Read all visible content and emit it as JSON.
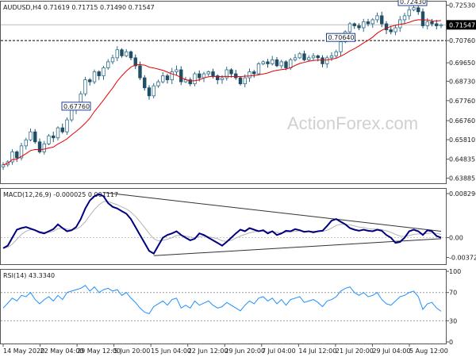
{
  "chart_data": [
    {
      "type": "candlestick",
      "title": "AUDUSD,H4",
      "ohlc": {
        "open": "0.71619",
        "high": "0.71715",
        "low": "0.71490",
        "close": "0.71547"
      },
      "ylim": [
        0.6375,
        0.7255
      ],
      "y_ticks": [
        "0.72530",
        "0.71547",
        "0.70760",
        "0.69650",
        "0.68730",
        "0.67760",
        "0.66760",
        "0.65810",
        "0.64835",
        "0.63885"
      ],
      "x_ticks": [
        "14 May 2020",
        "22 May 04:00",
        "29 May 12:00",
        "5 Jun 20:00",
        "15 Jun 04:00",
        "22 Jun 12:00",
        "29 Jun 20:00",
        "7 Jul 04:00",
        "14 Jul 12:00",
        "21 Jul 20:00",
        "29 Jul 04:00",
        "5 Aug 12:00"
      ],
      "annotations": [
        {
          "label": "0.70640",
          "value": 0.7064
        },
        {
          "label": "0.67760",
          "value": 0.6776
        },
        {
          "label": "0.72430",
          "value": 0.7243
        }
      ],
      "horizontal_lines": [
        {
          "label": "0.70760",
          "value": 0.7076,
          "style": "dashed"
        }
      ],
      "current_price": {
        "label": "0.71547",
        "value": 0.71547
      },
      "series_close": [
        0.6455,
        0.647,
        0.652,
        0.649,
        0.655,
        0.658,
        0.662,
        0.657,
        0.652,
        0.656,
        0.66,
        0.659,
        0.664,
        0.662,
        0.668,
        0.673,
        0.676,
        0.681,
        0.688,
        0.687,
        0.692,
        0.69,
        0.694,
        0.697,
        0.699,
        0.703,
        0.7,
        0.702,
        0.699,
        0.695,
        0.689,
        0.684,
        0.68,
        0.685,
        0.687,
        0.69,
        0.688,
        0.692,
        0.693,
        0.687,
        0.688,
        0.686,
        0.691,
        0.689,
        0.691,
        0.692,
        0.69,
        0.688,
        0.689,
        0.693,
        0.691,
        0.689,
        0.686,
        0.689,
        0.692,
        0.691,
        0.696,
        0.697,
        0.696,
        0.698,
        0.695,
        0.697,
        0.694,
        0.698,
        0.699,
        0.701,
        0.698,
        0.699,
        0.7,
        0.699,
        0.696,
        0.699,
        0.7,
        0.702,
        0.707,
        0.712,
        0.716,
        0.715,
        0.714,
        0.717,
        0.716,
        0.718,
        0.72,
        0.716,
        0.713,
        0.712,
        0.714,
        0.718,
        0.72,
        0.723,
        0.724,
        0.722,
        0.715,
        0.717,
        0.716,
        0.715,
        0.7155
      ]
    },
    {
      "type": "line",
      "title": "MACD(12,26,9) -0.000025 0.001117",
      "ylim": [
        -0.0047,
        0.0089
      ],
      "y_ticks": [
        "0.008296",
        "0.00",
        "-0.003725"
      ],
      "series": [
        {
          "name": "MACD",
          "color": "#00007f",
          "values": [
            -0.002,
            -0.0015,
            0.0,
            0.0015,
            0.0018,
            0.002,
            0.0017,
            0.0014,
            0.001,
            0.0008,
            0.0012,
            0.0016,
            0.0025,
            0.0018,
            0.0012,
            0.0014,
            0.002,
            0.0035,
            0.0055,
            0.007,
            0.0078,
            0.0082,
            0.0078,
            0.0065,
            0.0058,
            0.0055,
            0.005,
            0.0045,
            0.0035,
            0.002,
            0.0005,
            -0.001,
            -0.0025,
            -0.003,
            -0.0015,
            0.0,
            0.0005,
            0.0008,
            0.0012,
            0.0005,
            0.0,
            -0.0005,
            -0.0002,
            0.0008,
            0.0005,
            0.0,
            -0.0005,
            -0.001,
            -0.0015,
            -0.0008,
            0.0,
            0.0008,
            0.0015,
            0.0012,
            0.0018,
            0.0015,
            0.0012,
            0.0014,
            0.0008,
            0.0012,
            0.0005,
            0.0008,
            0.0013,
            0.0012,
            0.0016,
            0.0014,
            0.0011,
            0.0012,
            0.001,
            0.0012,
            0.0013,
            0.0022,
            0.0032,
            0.0035,
            0.003,
            0.0025,
            0.0018,
            0.0015,
            0.0013,
            0.0015,
            0.0013,
            0.0012,
            0.0015,
            0.0013,
            0.0005,
            0.0,
            -0.001,
            -0.0008,
            0.0,
            0.0012,
            0.0015,
            0.0012,
            0.0005,
            0.0014,
            0.0012,
            0.0003,
            0.0
          ]
        },
        {
          "name": "Signal",
          "color": "#b4b4b4",
          "values": [
            -0.002,
            -0.0018,
            -0.0012,
            -0.0003,
            0.0006,
            0.0012,
            0.0015,
            0.0014,
            0.0012,
            0.001,
            0.001,
            0.0012,
            0.0017,
            0.0018,
            0.0016,
            0.0015,
            0.0016,
            0.0021,
            0.003,
            0.0042,
            0.0053,
            0.0062,
            0.0068,
            0.0068,
            0.0065,
            0.0062,
            0.0058,
            0.0054,
            0.0048,
            0.004,
            0.003,
            0.0019,
            0.0008,
            -0.0002,
            -0.0006,
            -0.0005,
            -0.0003,
            0.0,
            0.0004,
            0.0004,
            0.0003,
            0.0001,
            0.0,
            0.0002,
            0.0003,
            0.0002,
            0.0,
            -0.0002,
            -0.0006,
            -0.0007,
            -0.0005,
            -0.0001,
            0.0003,
            0.0006,
            0.0009,
            0.0011,
            0.0012,
            0.0012,
            0.0011,
            0.0012,
            0.001,
            0.0009,
            0.001,
            0.0011,
            0.0012,
            0.0013,
            0.0012,
            0.0012,
            0.0012,
            0.0012,
            0.0012,
            0.0014,
            0.0018,
            0.0023,
            0.0025,
            0.0025,
            0.0024,
            0.0022,
            0.002,
            0.0019,
            0.0017,
            0.0016,
            0.0016,
            0.0015,
            0.0013,
            0.001,
            0.0006,
            0.0003,
            0.0002,
            0.0004,
            0.0006,
            0.0007,
            0.0007,
            0.0008,
            0.0009,
            0.0008,
            0.0006
          ]
        }
      ],
      "trendlines": [
        {
          "from": [
            0.0085,
            22
          ],
          "to": [
            0.0012,
            96
          ]
        },
        {
          "from": [
            -0.0034,
            33
          ],
          "to": [
            -0.0002,
            96
          ]
        }
      ]
    },
    {
      "type": "line",
      "title": "RSI(14) 43.3340",
      "ylim": [
        0,
        100
      ],
      "y_ticks": [
        "100",
        "70",
        "30",
        "0"
      ],
      "levels": [
        70,
        30
      ],
      "series": [
        {
          "name": "RSI(14)",
          "color": "#1e90ff",
          "values": [
            48,
            55,
            62,
            58,
            66,
            64,
            70,
            60,
            54,
            60,
            64,
            58,
            66,
            60,
            70,
            72,
            74,
            76,
            80,
            72,
            78,
            70,
            74,
            76,
            72,
            74,
            66,
            70,
            62,
            56,
            48,
            42,
            40,
            50,
            54,
            58,
            52,
            60,
            62,
            48,
            52,
            48,
            58,
            52,
            55,
            58,
            52,
            48,
            50,
            56,
            52,
            48,
            44,
            52,
            58,
            54,
            62,
            64,
            58,
            62,
            54,
            60,
            52,
            60,
            62,
            64,
            56,
            58,
            60,
            56,
            50,
            58,
            60,
            64,
            72,
            76,
            78,
            70,
            66,
            70,
            64,
            66,
            70,
            60,
            54,
            52,
            58,
            64,
            66,
            70,
            72,
            64,
            46,
            54,
            56,
            48,
            43.334
          ]
        }
      ]
    }
  ],
  "watermark": "ActionForex.com",
  "colors": {
    "candle_up": "#2e6e8a",
    "candle_down": "#1e4f66",
    "ma_line": "#e60000",
    "macd_line": "#00007f",
    "signal_line": "#b4b4b4",
    "rsi_line": "#1e90ff",
    "annotation_border": "#1f3d99",
    "price_label_bg": "#000000"
  }
}
